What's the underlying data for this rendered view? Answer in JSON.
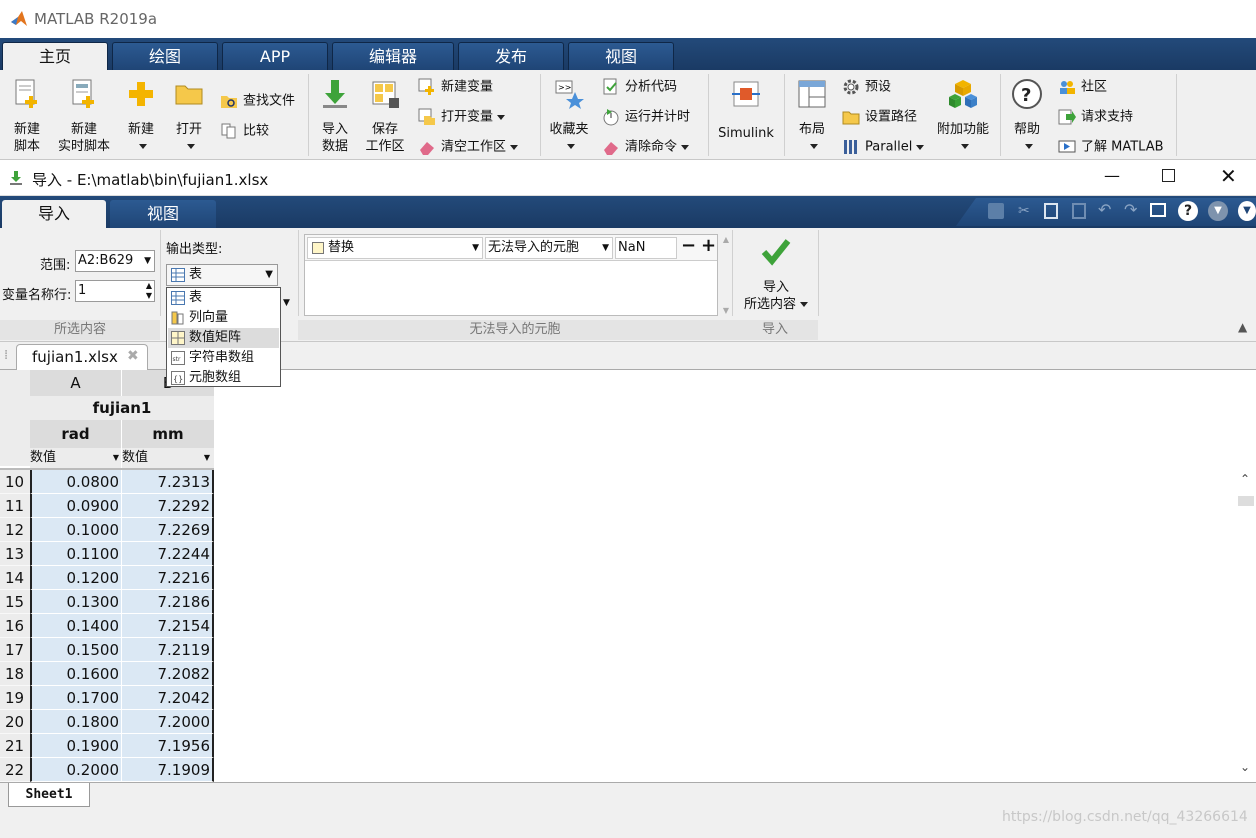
{
  "app": {
    "title": "MATLAB R2019a"
  },
  "main_tabs": [
    "主页",
    "绘图",
    "APP",
    "编辑器",
    "发布",
    "视图"
  ],
  "toolstrip": {
    "new_script": [
      "新建",
      "脚本"
    ],
    "new_live_script": [
      "新建",
      "实时脚本"
    ],
    "new": "新建",
    "open": "打开",
    "find_files": "查找文件",
    "compare": "比较",
    "import_data": [
      "导入",
      "数据"
    ],
    "save_workspace": [
      "保存",
      "工作区"
    ],
    "new_variable": "新建变量",
    "open_variable": "打开变量",
    "clear_workspace": "清空工作区",
    "favorites": "收藏夹",
    "analyze_code": "分析代码",
    "run_and_time": "运行并计时",
    "clear_commands": "清除命令",
    "simulink": "Simulink",
    "layout": "布局",
    "preferences": "预设",
    "set_path": "设置路径",
    "parallel": "Parallel",
    "addons": "附加功能",
    "help": "帮助",
    "community": "社区",
    "request_support": "请求支持",
    "learn_matlab": "了解 MATLAB"
  },
  "import_window": {
    "title": "导入 - E:\\matlab\\bin\\fujian1.xlsx",
    "tabs": [
      "导入",
      "视图"
    ],
    "range_label": "范围:",
    "range_value": "A2:B629",
    "varnames_label": "变量名称行:",
    "varnames_value": "1",
    "output_type_label": "输出类型:",
    "output_type_value": "表",
    "output_options": [
      "表",
      "列向量",
      "数值矩阵",
      "字符串数组",
      "元胞数组"
    ],
    "rule_action": "替换",
    "rule_condition": "无法导入的元胞",
    "rule_value": "NaN",
    "import_selection": [
      "导入",
      "所选内容"
    ],
    "group_labels": {
      "selection": "所选内容",
      "unimportable": "无法导入的元胞",
      "import": "导入"
    }
  },
  "file_tab": "fujian1.xlsx",
  "grid": {
    "col_letters": [
      "A",
      "B"
    ],
    "var_name": "fujian1",
    "columns": [
      "rad",
      "mm"
    ],
    "col_types": [
      "数值",
      "数值"
    ],
    "rows": [
      {
        "n": "10",
        "a": "0.0800",
        "b": "7.2313"
      },
      {
        "n": "11",
        "a": "0.0900",
        "b": "7.2292"
      },
      {
        "n": "12",
        "a": "0.1000",
        "b": "7.2269"
      },
      {
        "n": "13",
        "a": "0.1100",
        "b": "7.2244"
      },
      {
        "n": "14",
        "a": "0.1200",
        "b": "7.2216"
      },
      {
        "n": "15",
        "a": "0.1300",
        "b": "7.2186"
      },
      {
        "n": "16",
        "a": "0.1400",
        "b": "7.2154"
      },
      {
        "n": "17",
        "a": "0.1500",
        "b": "7.2119"
      },
      {
        "n": "18",
        "a": "0.1600",
        "b": "7.2082"
      },
      {
        "n": "19",
        "a": "0.1700",
        "b": "7.2042"
      },
      {
        "n": "20",
        "a": "0.1800",
        "b": "7.2000"
      },
      {
        "n": "21",
        "a": "0.1900",
        "b": "7.1956"
      },
      {
        "n": "22",
        "a": "0.2000",
        "b": "7.1909"
      }
    ]
  },
  "sheet_tab": "Sheet1",
  "watermark": "https://blog.csdn.net/qq_43266614",
  "colors": {
    "tab_blue": "#1f4576",
    "panel": "#f0f0f0",
    "cell_blue": "#dbe8f4",
    "accent_green": "#3ea33a"
  }
}
